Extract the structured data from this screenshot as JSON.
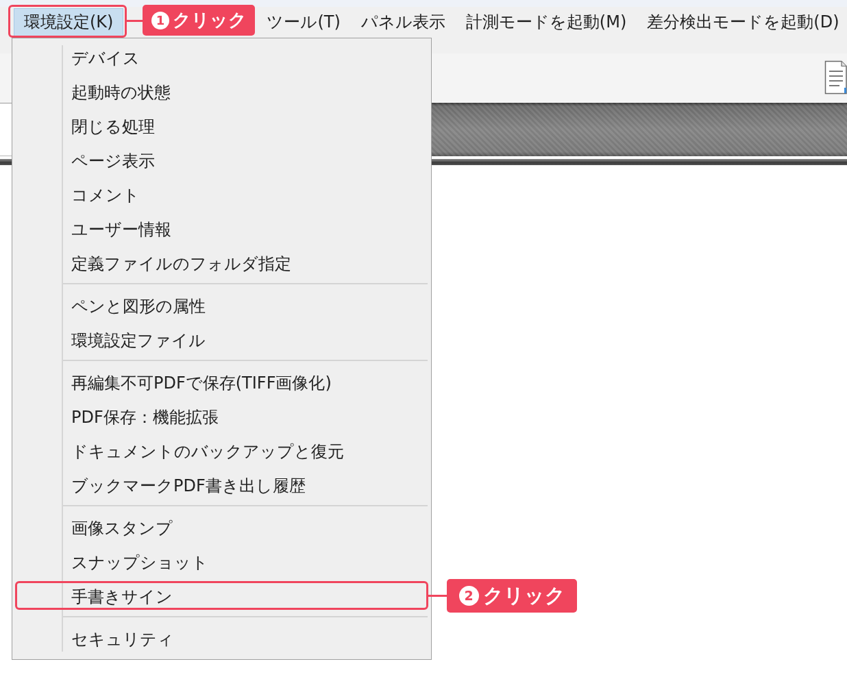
{
  "menu_bar": {
    "items": [
      {
        "label": "環境設定(K)",
        "selected": true,
        "callout": {
          "number": "1",
          "label": "クリック"
        }
      },
      {
        "label": "ツール(T)",
        "selected": false
      },
      {
        "label": "パネル表示",
        "selected": false
      },
      {
        "label": "計測モードを起動(M)",
        "selected": false
      },
      {
        "label": "差分検出モードを起動(D)",
        "selected": false
      }
    ]
  },
  "dropdown_menu": {
    "groups": [
      {
        "items": [
          {
            "label": "デバイス"
          },
          {
            "label": "起動時の状態"
          },
          {
            "label": "閉じる処理"
          },
          {
            "label": "ページ表示"
          },
          {
            "label": "コメント"
          },
          {
            "label": "ユーザー情報"
          },
          {
            "label": "定義ファイルのフォルダ指定"
          }
        ]
      },
      {
        "items": [
          {
            "label": "ペンと図形の属性"
          },
          {
            "label": "環境設定ファイル"
          }
        ]
      },
      {
        "items": [
          {
            "label": "再編集不可PDFで保存(TIFF画像化)"
          },
          {
            "label": "PDF保存：機能拡張"
          },
          {
            "label": "ドキュメントのバックアップと復元"
          },
          {
            "label": "ブックマークPDF書き出し履歴"
          }
        ]
      },
      {
        "items": [
          {
            "label": "画像スタンプ"
          },
          {
            "label": "スナップショット"
          },
          {
            "label": "手書きサイン",
            "callout": {
              "number": "2",
              "label": "クリック"
            }
          }
        ]
      },
      {
        "items": [
          {
            "label": "セキュリティ"
          }
        ]
      }
    ]
  }
}
